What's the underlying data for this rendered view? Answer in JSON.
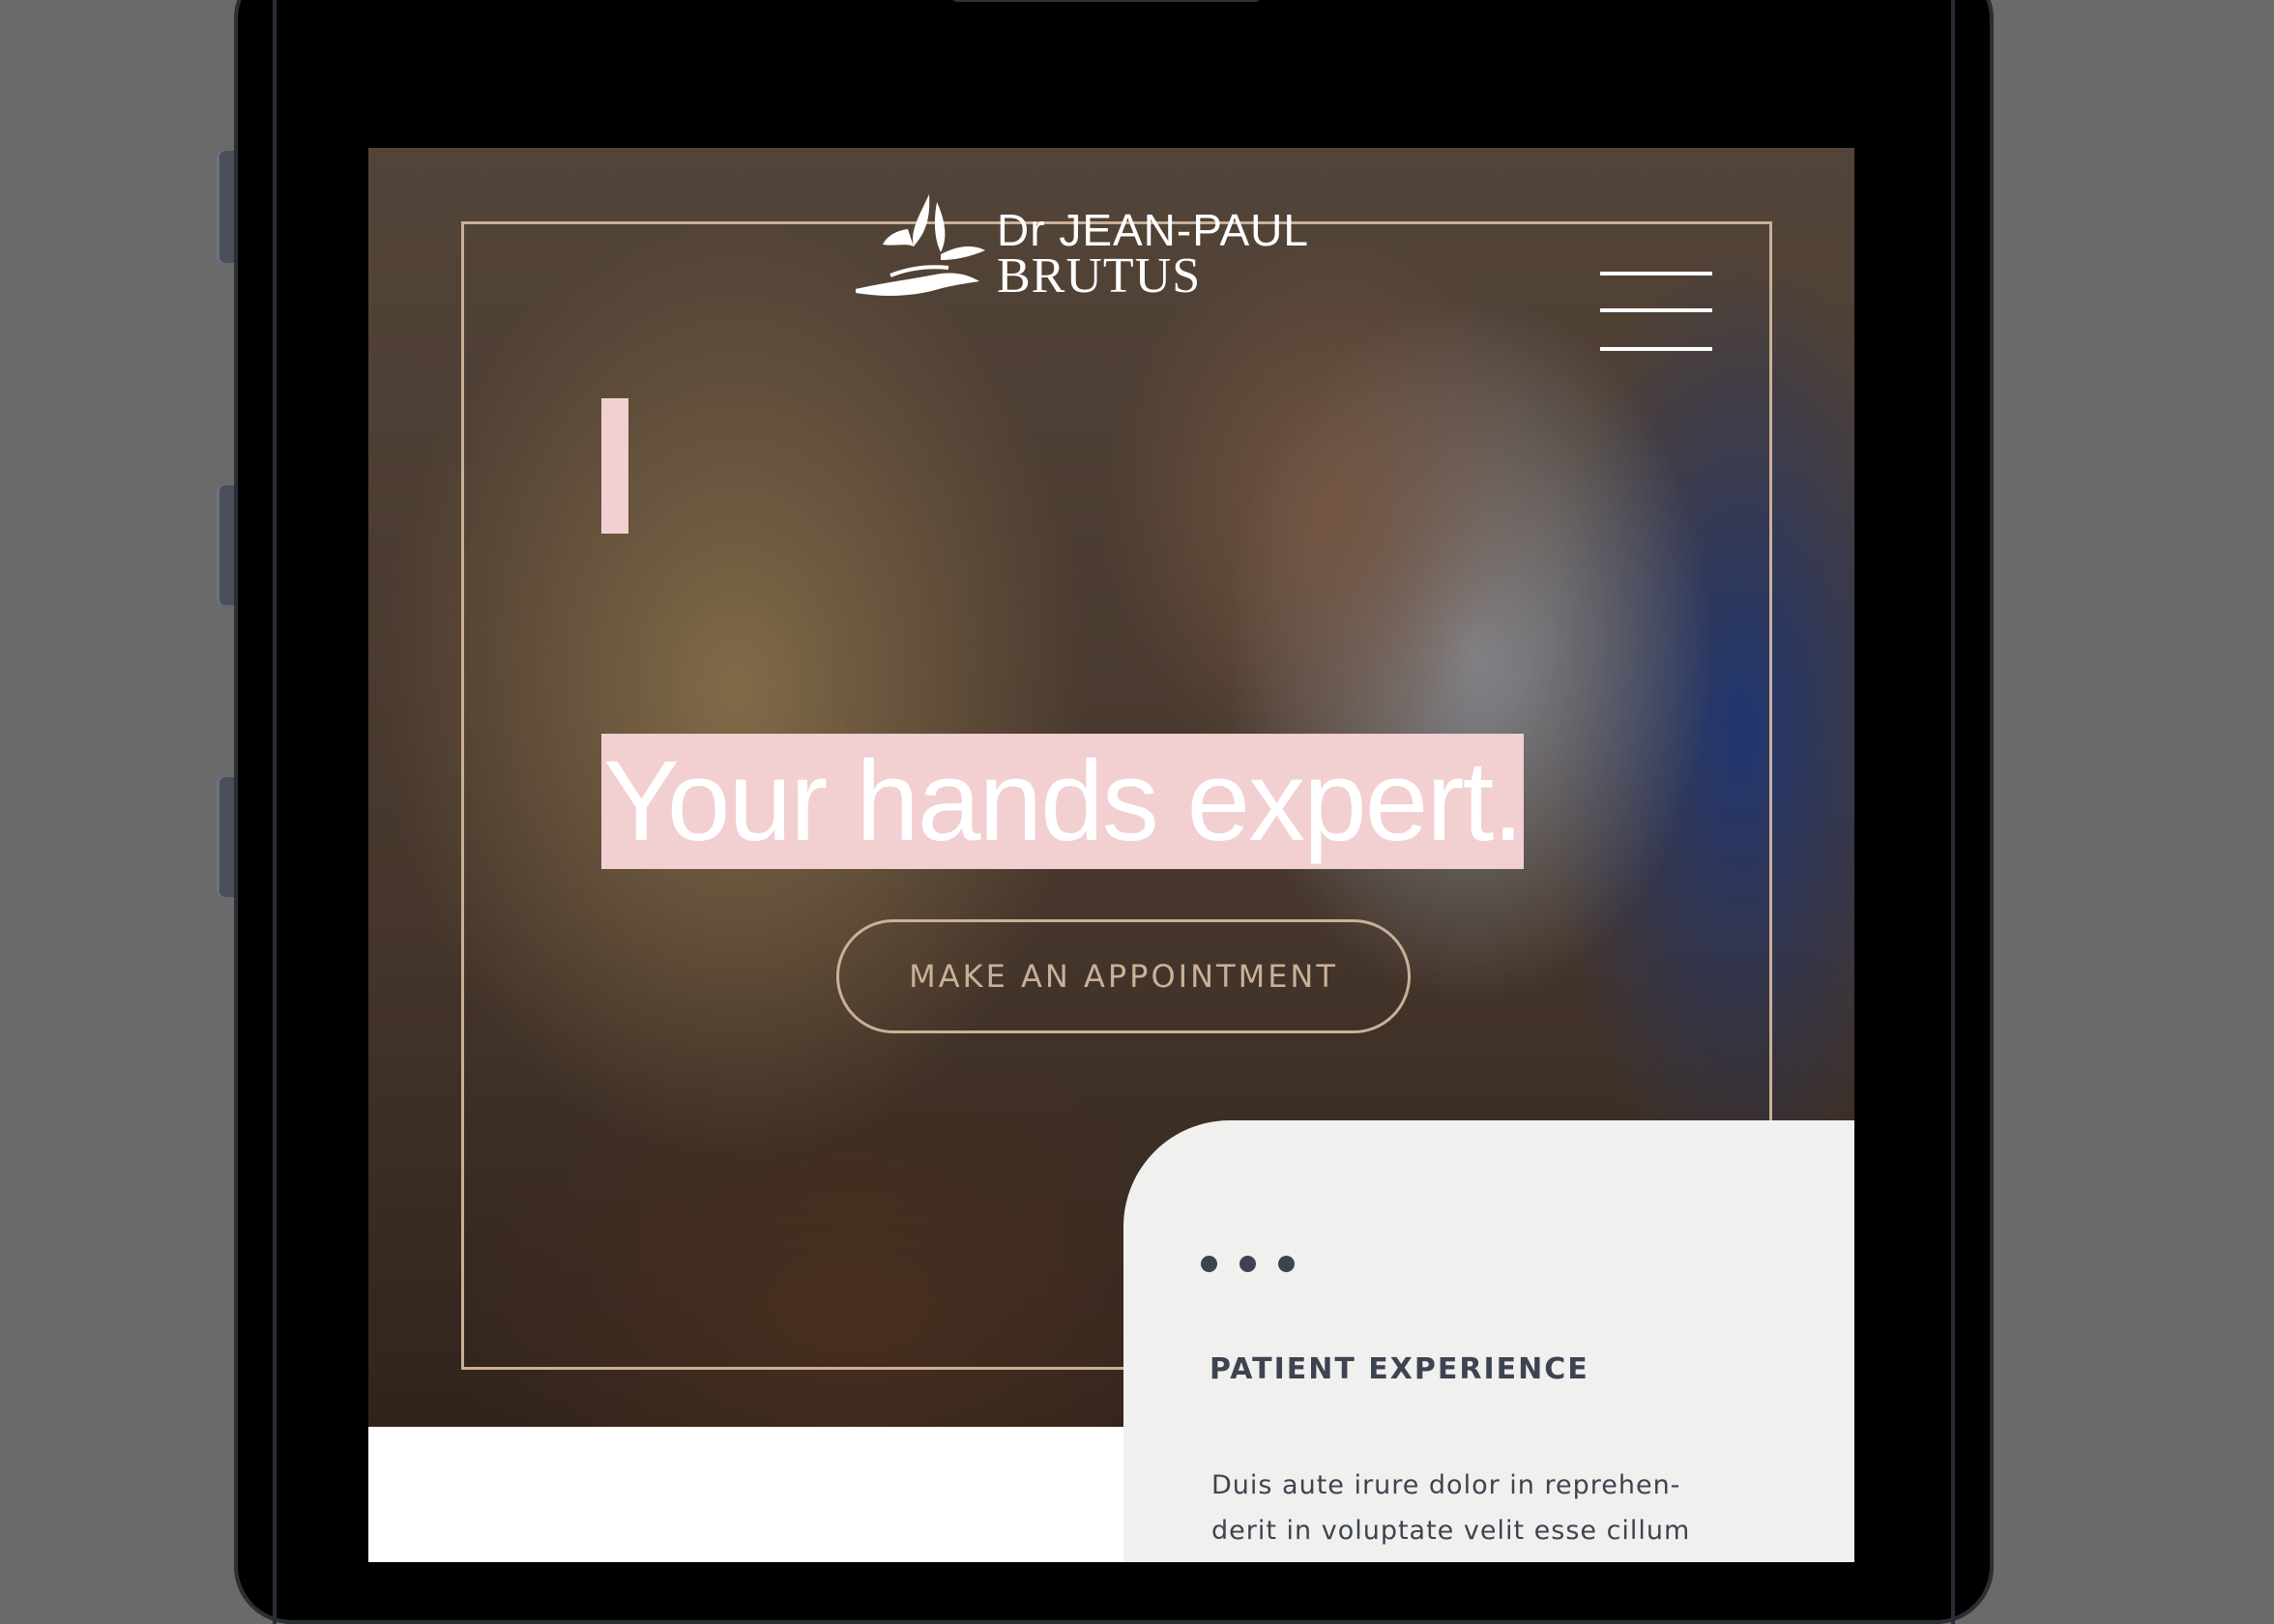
{
  "logo": {
    "line1": "Dr JEAN-PAUL",
    "line2": "BRUTUS",
    "icon": "butterfly-hand-icon"
  },
  "menu": {
    "icon": "hamburger-menu-icon"
  },
  "hero": {
    "headline": "Your hands expert.",
    "cta_label": "MAKE AN APPOINTMENT"
  },
  "card": {
    "icon": "ellipsis-icon",
    "title": "PATIENT EXPERIENCE",
    "text_line1": "Duis aute irure dolor in reprehen-",
    "text_line2": "derit in voluptate velit esse cillum"
  },
  "colors": {
    "accent_pink": "#f2cfd0",
    "frame_gold": "#c9b097",
    "card_bg": "#f0f0ee",
    "text_dark": "#3d4350"
  }
}
